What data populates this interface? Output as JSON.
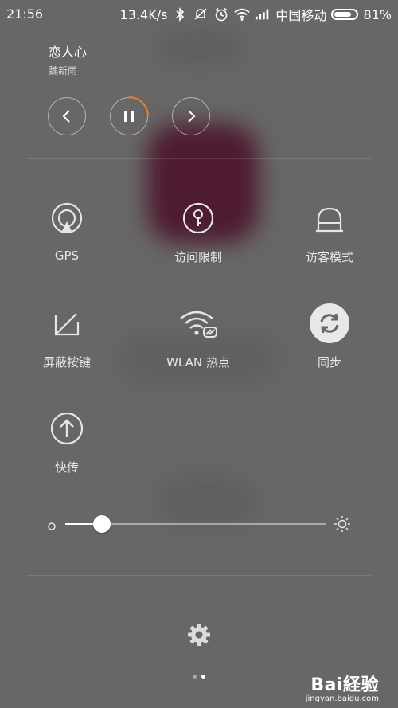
{
  "statusbar": {
    "time": "21:56",
    "speed": "13.4K/s",
    "carrier": "中国移动",
    "battery_percent": "81%",
    "battery_level": 0.81,
    "icons": [
      "bluetooth-icon",
      "mute-icon",
      "alarm-icon",
      "wifi-icon",
      "signal-icon",
      "battery-icon"
    ]
  },
  "music": {
    "title": "恋人心",
    "artist": "魏新雨",
    "controls": [
      "previous-icon",
      "pause-icon",
      "next-icon"
    ],
    "progress_accent": "#f07a2b"
  },
  "tiles": [
    {
      "label": "GPS",
      "icon": "gps-icon"
    },
    {
      "label": "访问限制",
      "icon": "key-icon"
    },
    {
      "label": "访客模式",
      "icon": "bell-icon"
    },
    {
      "label": "屏蔽按键",
      "icon": "key-block-icon"
    },
    {
      "label": "WLAN 热点",
      "icon": "hotspot-icon"
    },
    {
      "label": "同步",
      "icon": "sync-icon"
    },
    {
      "label": "快传",
      "icon": "upload-icon"
    }
  ],
  "brightness": {
    "level": 0.14,
    "min_icon": "brightness-low-icon",
    "max_icon": "brightness-high-icon"
  },
  "footer": {
    "settings_icon": "gear-icon",
    "pages": 2,
    "active_page": 2
  },
  "watermark": {
    "brand": "Bai経验",
    "url": "jingyan.baidu.com"
  }
}
